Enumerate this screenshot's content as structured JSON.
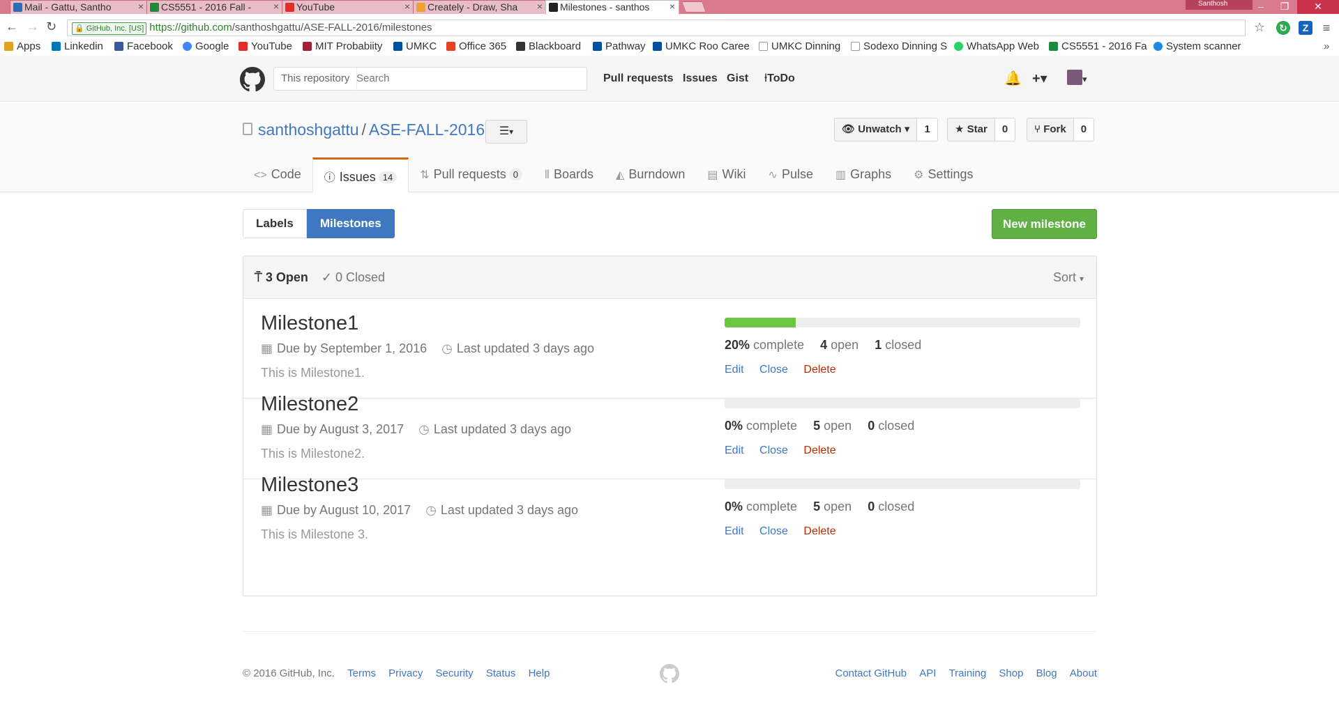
{
  "browser": {
    "tabs": [
      {
        "label": "Mail - Gattu, Santho",
        "icon": "mail-icon",
        "color": "#2a6ebb"
      },
      {
        "label": "CS5551 - 2016 Fall -",
        "icon": "sheet-icon",
        "color": "#1e8a3c"
      },
      {
        "label": "YouTube",
        "icon": "youtube-icon",
        "color": "#e52d27"
      },
      {
        "label": "Creately - Draw, Sha",
        "icon": "creately-icon",
        "color": "#f0a030"
      },
      {
        "label": "Milestones - santhos",
        "icon": "github-icon",
        "color": "#222222"
      }
    ],
    "profile_name": "Santhosh",
    "secure_label": "GitHub, Inc. [US]",
    "url_host": "https://github.com",
    "url_path": "/santhoshgattu/ASE-FALL-2016/milestones",
    "bookmarks": [
      {
        "label": "Apps",
        "icon": "apps-icon",
        "color": "#e0a020"
      },
      {
        "label": "Linkedin",
        "icon": "linkedin-icon",
        "color": "#0077b5"
      },
      {
        "label": "Facebook",
        "icon": "facebook-icon",
        "color": "#3b5998"
      },
      {
        "label": "Google",
        "icon": "google-icon",
        "color": "#4285f4"
      },
      {
        "label": "YouTube",
        "icon": "youtube-icon",
        "color": "#e52d27"
      },
      {
        "label": "MIT Probabiity",
        "icon": "mit-icon",
        "color": "#a31f34"
      },
      {
        "label": "UMKC",
        "icon": "umkc-icon",
        "color": "#0050a0"
      },
      {
        "label": "Office 365",
        "icon": "office-icon",
        "color": "#e74025"
      },
      {
        "label": "Blackboard",
        "icon": "blackboard-icon",
        "color": "#333333"
      },
      {
        "label": "Pathway",
        "icon": "pathway-icon",
        "color": "#0050a0"
      },
      {
        "label": "UMKC Roo Caree",
        "icon": "umkc-icon",
        "color": "#0050a0"
      },
      {
        "label": "UMKC Dinning",
        "icon": "page-icon",
        "color": "#999999"
      },
      {
        "label": "Sodexo Dinning S",
        "icon": "page-icon",
        "color": "#999999"
      },
      {
        "label": "WhatsApp Web",
        "icon": "whatsapp-icon",
        "color": "#25d366"
      },
      {
        "label": "CS5551 - 2016 Fa",
        "icon": "sheet-icon",
        "color": "#1e8a3c"
      },
      {
        "label": "System scanner",
        "icon": "scanner-icon",
        "color": "#1e88e5"
      }
    ]
  },
  "header": {
    "scope_label": "This repository",
    "search_placeholder": "Search",
    "nav": [
      "Pull requests",
      "Issues",
      "Gist",
      "ToDo"
    ]
  },
  "repo": {
    "owner": "santhoshgattu",
    "name": "ASE-FALL-2016",
    "watch_label": "Unwatch",
    "watch_count": "1",
    "star_label": "Star",
    "star_count": "0",
    "fork_label": "Fork",
    "fork_count": "0",
    "tabs": [
      {
        "label": "Code",
        "icon": "<>"
      },
      {
        "label": "Issues",
        "icon": "!",
        "count": "14"
      },
      {
        "label": "Pull requests",
        "icon": "⇅",
        "count": "0"
      },
      {
        "label": "Boards",
        "icon": "|||"
      },
      {
        "label": "Burndown",
        "icon": "▲"
      },
      {
        "label": "Wiki",
        "icon": "▤"
      },
      {
        "label": "Pulse",
        "icon": "~"
      },
      {
        "label": "Graphs",
        "icon": "▥"
      },
      {
        "label": "Settings",
        "icon": "⚙"
      }
    ]
  },
  "subnav": {
    "labels": "Labels",
    "milestones": "Milestones",
    "new_milestone": "New milestone"
  },
  "list": {
    "open_label": "3 Open",
    "closed_label": "0 Closed",
    "sort_label": "Sort"
  },
  "milestones": [
    {
      "title": "Milestone1",
      "due": "Due by September 1, 2016",
      "updated": "Last updated 3 days ago",
      "description": "This is Milestone1.",
      "progress": 20,
      "percent_label": "20%",
      "complete_label": "complete",
      "open_count": "4",
      "open_label": "open",
      "closed_count": "1",
      "closed_label": "closed",
      "actions": [
        "Edit",
        "Close",
        "Delete"
      ]
    },
    {
      "title": "Milestone2",
      "due": "Due by August 3, 2017",
      "updated": "Last updated 3 days ago",
      "description": "This is Milestone2.",
      "progress": 0,
      "percent_label": "0%",
      "complete_label": "complete",
      "open_count": "5",
      "open_label": "open",
      "closed_count": "0",
      "closed_label": "closed",
      "actions": [
        "Edit",
        "Close",
        "Delete"
      ]
    },
    {
      "title": "Milestone3",
      "due": "Due by August 10, 2017",
      "updated": "Last updated 3 days ago",
      "description": "This is Milestone 3.",
      "progress": 0,
      "percent_label": "0%",
      "complete_label": "complete",
      "open_count": "5",
      "open_label": "open",
      "closed_count": "0",
      "closed_label": "closed",
      "actions": [
        "Edit",
        "Close",
        "Delete"
      ]
    }
  ],
  "footer": {
    "copyright": "© 2016 GitHub, Inc.",
    "left_links": [
      "Terms",
      "Privacy",
      "Security",
      "Status",
      "Help"
    ],
    "right_links": [
      "Contact GitHub",
      "API",
      "Training",
      "Shop",
      "Blog",
      "About"
    ]
  }
}
